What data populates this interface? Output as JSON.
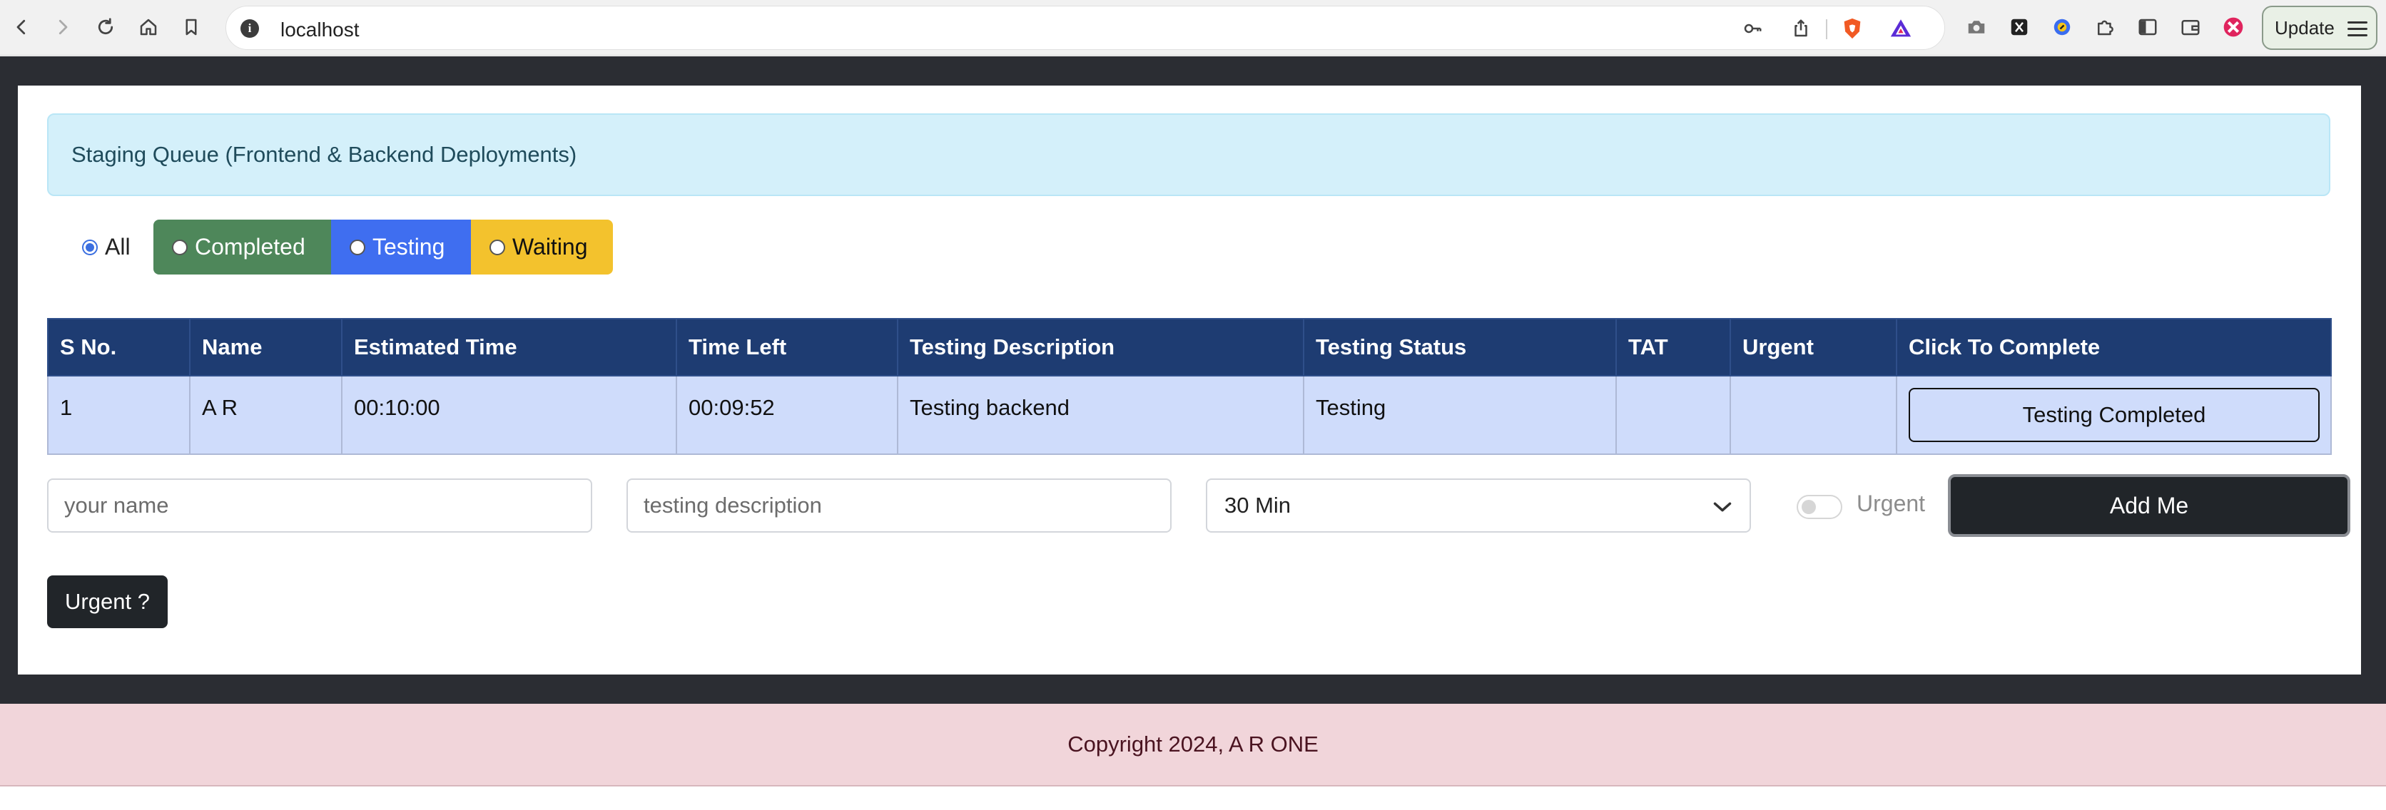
{
  "browser": {
    "url": "localhost",
    "info_glyph": "i",
    "update_label": "Update"
  },
  "page": {
    "alert_text": "Staging Queue (Frontend & Backend Deployments)",
    "filters": {
      "all": "All",
      "completed": "Completed",
      "testing": "Testing",
      "waiting": "Waiting",
      "selected": "All"
    },
    "table": {
      "headers": [
        "S No.",
        "Name",
        "Estimated Time",
        "Time Left",
        "Testing Description",
        "Testing Status",
        "TAT",
        "Urgent",
        "Click To Complete"
      ],
      "rows": [
        {
          "sno": "1",
          "name": "A R",
          "estimated_time": "00:10:00",
          "time_left": "00:09:52",
          "description": "Testing backend",
          "status": "Testing",
          "tat": "",
          "urgent": "",
          "action_label": "Testing Completed"
        }
      ]
    },
    "form": {
      "name_placeholder": "your name",
      "description_placeholder": "testing description",
      "duration_value": "30 Min",
      "urgent_toggle_label": "Urgent",
      "add_button": "Add Me"
    },
    "urgent_button": "Urgent ?",
    "footer_text": "Copyright 2024, A R ONE"
  },
  "colors": {
    "alert_bg": "#d4f0fa",
    "completed": "#4e875a",
    "testing": "#3f6ef0",
    "waiting": "#f3c22d",
    "table_header": "#1e3c72",
    "table_row": "#cfdcfb",
    "dark_button": "#212529",
    "footer_bg": "#f1d5da"
  },
  "icons": [
    "back-icon",
    "forward-icon",
    "reload-icon",
    "home-icon",
    "bookmark-icon",
    "key-icon",
    "share-icon",
    "brave-shield-icon",
    "brave-rewards-icon",
    "camera-icon",
    "x-extension-icon",
    "compass-extension-icon",
    "puzzle-extensions-icon",
    "sidebar-icon",
    "wallet-icon",
    "profile-extension-icon",
    "menu-icon",
    "chevron-down-icon"
  ]
}
